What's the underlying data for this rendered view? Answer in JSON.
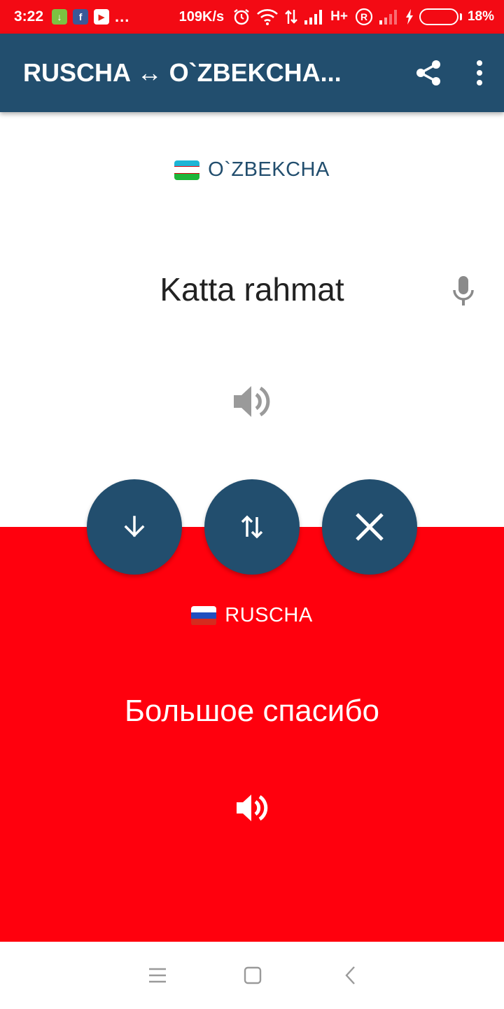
{
  "status_bar": {
    "time": "3:22",
    "network_speed": "109K/s",
    "network_type": "H+",
    "roaming": "R",
    "more_indicator": "...",
    "battery_percent": "18%",
    "battery_level": 0.18,
    "notification_icons": [
      "download-icon",
      "facebook-icon",
      "youtube-icon"
    ],
    "system_icons": [
      "alarm-icon",
      "wifi-icon",
      "data-transfer-icon",
      "signal-icon",
      "signal-icon",
      "charging-icon",
      "battery-icon"
    ]
  },
  "app_bar": {
    "title": "RUSCHA ↔ O`ZBEKCHA...",
    "actions": [
      "share-icon",
      "more-vert-icon"
    ],
    "background_color": "#224e6e"
  },
  "source": {
    "language": "O`ZBEKCHA",
    "flag": "uzbekistan-flag",
    "text": "Katta rahmat",
    "icons": [
      "microphone-icon",
      "speaker-icon"
    ]
  },
  "actions": {
    "buttons": [
      "arrow-down-icon",
      "swap-icon",
      "close-icon"
    ],
    "color": "#224e6e"
  },
  "target": {
    "language": "RUSCHA",
    "flag": "russia-flag",
    "text": "Большое спасибо",
    "icons": [
      "speaker-icon"
    ],
    "background_color": "#ff000d"
  },
  "nav_bar": {
    "icons": [
      "menu-icon",
      "home-icon",
      "back-icon"
    ]
  }
}
